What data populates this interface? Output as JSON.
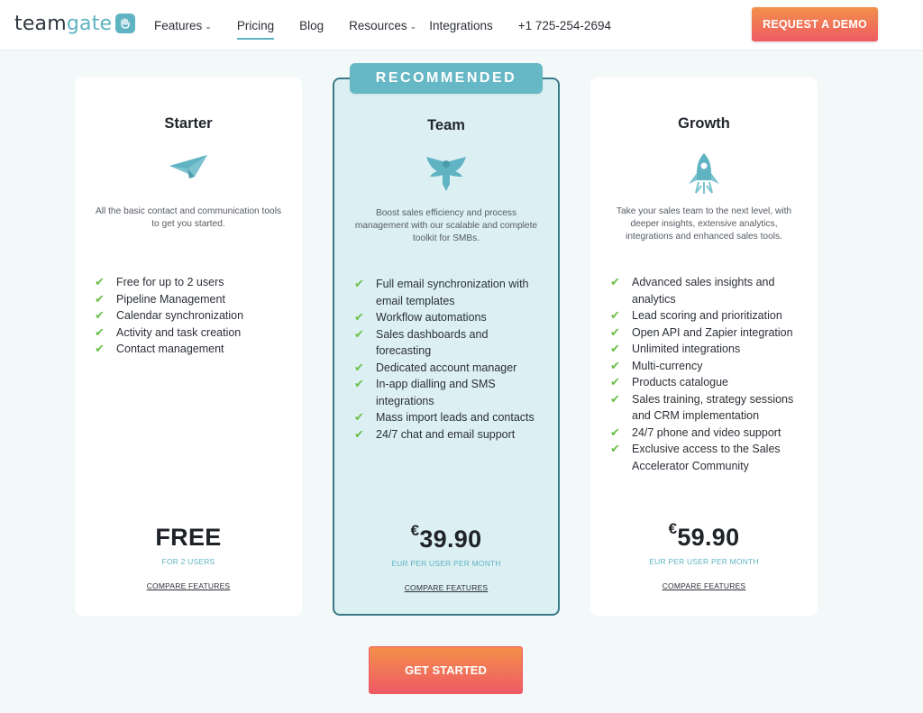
{
  "header": {
    "logo": {
      "text_main": "team",
      "text_accent": "gate"
    },
    "nav": [
      {
        "label": "Features",
        "dropdown": true,
        "active": false
      },
      {
        "label": "Pricing",
        "dropdown": false,
        "active": true
      },
      {
        "label": "Blog",
        "dropdown": false,
        "active": false
      },
      {
        "label": "Resources",
        "dropdown": true,
        "active": false
      },
      {
        "label": "Integrations",
        "dropdown": false,
        "active": false
      },
      {
        "label": "+1 725-254-2694",
        "dropdown": false,
        "active": false
      }
    ],
    "demo_label": "REQUEST A DEMO"
  },
  "plans": {
    "starter": {
      "name": "Starter",
      "icon": "paper-plane-icon",
      "description": "All the basic contact and communication tools to get you started.",
      "features": [
        "Free for up to 2 users",
        "Pipeline Management",
        "Calendar synchronization",
        "Activity and task creation",
        "Contact management"
      ],
      "price": "FREE",
      "price_sub": "FOR 2 USERS",
      "compare_label": "COMPARE FEATURES"
    },
    "team": {
      "ribbon": "RECOMMENDED",
      "name": "Team",
      "icon": "eagle-icon",
      "description": "Boost sales efficiency and process management with our scalable and complete toolkit for SMBs.",
      "features": [
        "Full email synchronization with email templates",
        "Workflow automations",
        "Sales dashboards and forecasting",
        "Dedicated account manager",
        "In-app dialling and SMS integrations",
        "Mass import leads and contacts",
        "24/7 chat and email support"
      ],
      "currency": "€",
      "price": "39.90",
      "price_sub": "EUR PER USER PER MONTH",
      "compare_label": "COMPARE FEATURES"
    },
    "growth": {
      "name": "Growth",
      "icon": "rocket-icon",
      "description": "Take your sales team to the next level, with deeper insights, extensive analytics, integrations and enhanced sales tools.",
      "features": [
        "Advanced sales insights and analytics",
        "Lead scoring and prioritization",
        "Open API and Zapier integration",
        "Unlimited integrations",
        "Multi-currency",
        "Products catalogue",
        "Sales training, strategy sessions and CRM implementation",
        "24/7 phone and video support",
        "Exclusive access to the Sales Accelerator Community"
      ],
      "currency": "€",
      "price": "59.90",
      "price_sub": "EUR PER USER PER MONTH",
      "compare_label": "COMPARE FEATURES"
    }
  },
  "cta": {
    "label": "GET STARTED"
  },
  "colors": {
    "accent": "#5fb3c2",
    "check": "#6cc04a",
    "cta_start": "#f3904a",
    "cta_end": "#ee5a64",
    "team_bg": "#dcf0f3",
    "team_border": "#3a7a88"
  }
}
